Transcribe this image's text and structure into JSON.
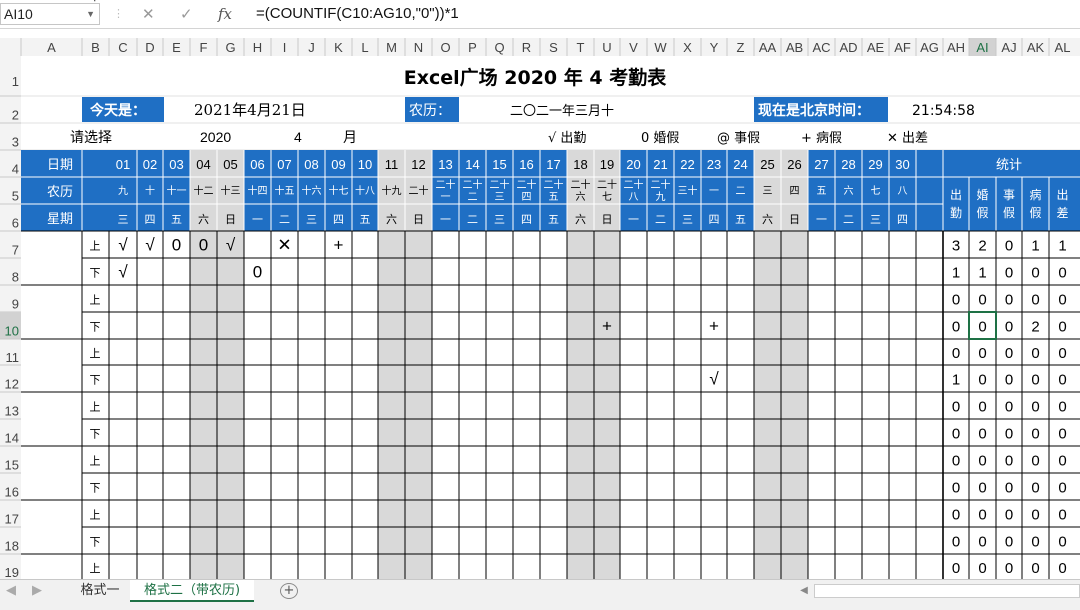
{
  "formula_bar": {
    "name_box": "AI10",
    "cancel_icon": "✕",
    "enter_icon": "✓",
    "fx_label": "fx",
    "formula": "=(COUNTIF(C10:AG10,\"0\"))*1"
  },
  "columns": [
    "A",
    "B",
    "C",
    "D",
    "E",
    "F",
    "G",
    "H",
    "I",
    "J",
    "K",
    "L",
    "M",
    "N",
    "O",
    "P",
    "Q",
    "R",
    "S",
    "T",
    "U",
    "V",
    "W",
    "X",
    "Y",
    "Z",
    "AA",
    "AB",
    "AC",
    "AD",
    "AE",
    "AF",
    "AG",
    "AH",
    "AI",
    "AJ",
    "AK",
    "AL"
  ],
  "rows": [
    "1",
    "2",
    "3",
    "4",
    "5",
    "6",
    "7",
    "8",
    "9",
    "10",
    "11",
    "12",
    "13",
    "14",
    "15",
    "16",
    "17",
    "18",
    "19"
  ],
  "title": "Excel广场 2020  年  4 考勤表",
  "today_label": "今天是：",
  "today_value": "2021年4月21日",
  "lunar_label": "农历：",
  "lunar_value": "二〇二一年三月十",
  "time_label": "现在是北京时间：",
  "time_value": "21:54:58",
  "select_label": "请选择",
  "year": "2020",
  "month": "4",
  "month_unit": "月",
  "legend": [
    "√ 出勤",
    "0 婚假",
    "@ 事假",
    "+ 病假",
    "✕ 出差"
  ],
  "hdr_date": "日期",
  "hdr_lunar": "农历",
  "hdr_week": "星期",
  "hdr_stat": "统计",
  "days": [
    "01",
    "02",
    "03",
    "04",
    "05",
    "06",
    "07",
    "08",
    "09",
    "10",
    "11",
    "12",
    "13",
    "14",
    "15",
    "16",
    "17",
    "18",
    "19",
    "20",
    "21",
    "22",
    "23",
    "24",
    "25",
    "26",
    "27",
    "28",
    "29",
    "30"
  ],
  "lunar": [
    "九",
    "十",
    "十一",
    "十二",
    "十三",
    "十四",
    "十五",
    "十六",
    "十七",
    "十八",
    "十九",
    "二十",
    "二十一",
    "二十二",
    "二十三",
    "二十四",
    "二十五",
    "二十六",
    "二十七",
    "二十八",
    "二十九",
    "三十",
    "一",
    "二",
    "三",
    "四",
    "五",
    "六",
    "七",
    "八"
  ],
  "week": [
    "三",
    "四",
    "五",
    "六",
    "日",
    "一",
    "二",
    "三",
    "四",
    "五",
    "六",
    "日",
    "一",
    "二",
    "三",
    "四",
    "五",
    "六",
    "日",
    "一",
    "二",
    "三",
    "四",
    "五",
    "六",
    "日",
    "一",
    "二",
    "三",
    "四"
  ],
  "weekend": [
    4,
    5,
    11,
    12,
    18,
    19,
    25,
    26
  ],
  "stat_heads": [
    "出勤",
    "婚假",
    "事假",
    "病假",
    "出差"
  ],
  "halves": [
    "上",
    "下",
    "上",
    "下",
    "上",
    "下",
    "上",
    "下",
    "上",
    "下",
    "上",
    "下",
    "上",
    "下"
  ],
  "marks": [
    {
      "row": 7,
      "day": 1,
      "v": "√"
    },
    {
      "row": 7,
      "day": 2,
      "v": "√"
    },
    {
      "row": 7,
      "day": 3,
      "v": "0"
    },
    {
      "row": 7,
      "day": 4,
      "v": "0"
    },
    {
      "row": 7,
      "day": 5,
      "v": "√"
    },
    {
      "row": 7,
      "day": 7,
      "v": "✕"
    },
    {
      "row": 7,
      "day": 9,
      "v": "+"
    },
    {
      "row": 8,
      "day": 1,
      "v": "√"
    },
    {
      "row": 8,
      "day": 6,
      "v": "0"
    },
    {
      "row": 10,
      "day": 19,
      "v": "+"
    },
    {
      "row": 10,
      "day": 23,
      "v": "+"
    },
    {
      "row": 12,
      "day": 23,
      "v": "√"
    }
  ],
  "stats": [
    [
      "3",
      "2",
      "0",
      "1",
      "1"
    ],
    [
      "1",
      "1",
      "0",
      "0",
      "0"
    ],
    [
      "0",
      "0",
      "0",
      "0",
      "0"
    ],
    [
      "0",
      "0",
      "0",
      "2",
      "0"
    ],
    [
      "0",
      "0",
      "0",
      "0",
      "0"
    ],
    [
      "1",
      "0",
      "0",
      "0",
      "0"
    ],
    [
      "0",
      "0",
      "0",
      "0",
      "0"
    ],
    [
      "0",
      "0",
      "0",
      "0",
      "0"
    ],
    [
      "0",
      "0",
      "0",
      "0",
      "0"
    ],
    [
      "0",
      "0",
      "0",
      "0",
      "0"
    ],
    [
      "0",
      "0",
      "0",
      "0",
      "0"
    ],
    [
      "0",
      "0",
      "0",
      "0",
      "0"
    ],
    [
      "0",
      "0",
      "0",
      "0",
      "0"
    ]
  ],
  "sheet_tabs": [
    "格式一",
    "格式二（带农历)"
  ],
  "colors": {
    "header_blue": "#1f6fc4",
    "weekend_gray": "#d9d9d9",
    "grid_line": "#000000",
    "light_grid": "#e0e0e0",
    "active_green": "#1e7145"
  }
}
